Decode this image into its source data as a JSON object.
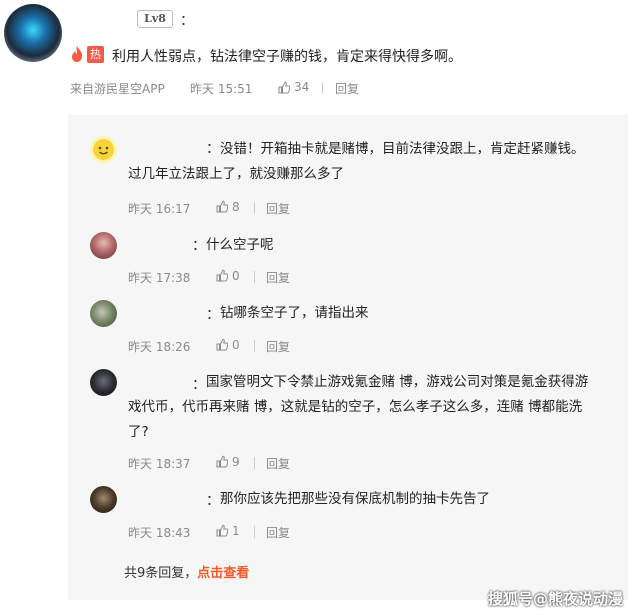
{
  "main_comment": {
    "level": "Lv8",
    "colon": "：",
    "hot_badge": "热",
    "text": "利用人性弱点，钻法律空子赚的钱，肯定来得快得多啊。",
    "source": "来自游民星空APP",
    "time": "昨天 15:51",
    "likes": "34",
    "reply_label": "回复"
  },
  "replies": [
    {
      "colon": "：",
      "line1": "没错！开箱抽卡就是赌博，目前法律没跟上，肯定赶紧赚钱。",
      "line2": "过几年立法跟上了，就没赚那么多了",
      "line3": "",
      "time": "昨天 16:17",
      "likes": "8",
      "reply_label": "回复"
    },
    {
      "colon": "：",
      "line1": "什么空子呢",
      "line2": "",
      "line3": "",
      "time": "昨天 17:38",
      "likes": "0",
      "reply_label": "回复"
    },
    {
      "colon": "：",
      "line1": "钻哪条空子了，请指出来",
      "line2": "",
      "line3": "",
      "time": "昨天 18:26",
      "likes": "0",
      "reply_label": "回复"
    },
    {
      "colon": "：",
      "line1": "国家管明文下令禁止游戏氪金赌 博，游戏公司对策是氪金获得游",
      "line2": "戏代币，代币再来赌 博，这就是钻的空子，怎么孝子这么多，连赌 博都能洗",
      "line3": "了?",
      "time": "昨天 18:37",
      "likes": "9",
      "reply_label": "回复"
    },
    {
      "colon": "：",
      "line1": "那你应该先把那些没有保底机制的抽卡先告了",
      "line2": "",
      "line3": "",
      "time": "昨天 18:43",
      "likes": "1",
      "reply_label": "回复"
    }
  ],
  "more": {
    "count_text": "共9条回复，",
    "link_text": "点击查看"
  },
  "watermark": "搜狐号@熊夜说动漫",
  "colors": {
    "hot": "#f25c4a",
    "link": "#f05a2a",
    "meta": "#8a8a8a",
    "reply_bg": "#f6f6f6"
  }
}
